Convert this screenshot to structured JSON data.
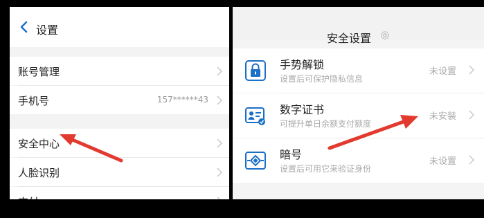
{
  "left": {
    "title": "设置",
    "items": [
      {
        "label": "账号管理",
        "value": ""
      },
      {
        "label": "手机号",
        "value": "157******43"
      },
      {
        "label": "安全中心",
        "value": ""
      },
      {
        "label": "人脸识别",
        "value": ""
      },
      {
        "label": "支付",
        "value": ""
      }
    ]
  },
  "right": {
    "title": "安全设置",
    "items": [
      {
        "title": "手势解锁",
        "subtitle": "设置后可保护隐私信息",
        "status": "未设置",
        "icon": "lock-icon"
      },
      {
        "title": "数字证书",
        "subtitle": "可提升单日余额支付额度",
        "status": "未安装",
        "icon": "certificate-icon"
      },
      {
        "title": "暗号",
        "subtitle": "设置后可用它来验证身份",
        "status": "未设置",
        "icon": "cipher-icon"
      }
    ]
  },
  "colors": {
    "accent": "#1a6fc7",
    "arrow": "#e23a2e"
  }
}
